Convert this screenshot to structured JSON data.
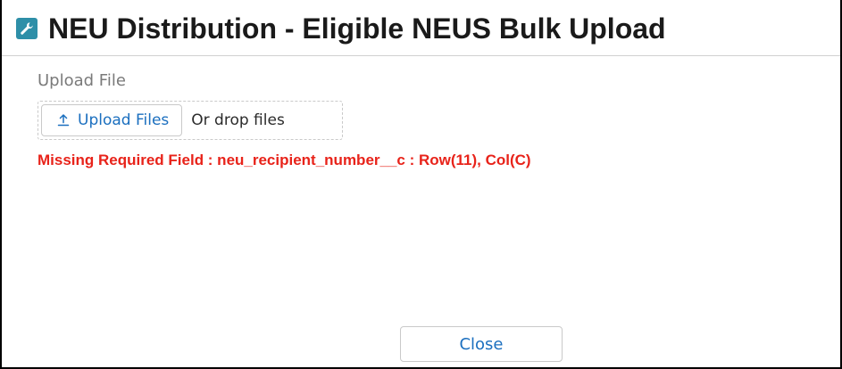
{
  "modal": {
    "title": "NEU Distribution - Eligible NEUS Bulk Upload",
    "title_icon": "wrench-icon",
    "accent_color": "#2e8fa8"
  },
  "upload": {
    "field_label": "Upload File",
    "button_label": "Upload Files",
    "button_icon": "upload-icon",
    "drop_text": "Or drop files"
  },
  "error": {
    "message": "Missing Required Field : neu_recipient_number__c : Row(11), Col(C)",
    "color": "#e8231a"
  },
  "footer": {
    "close_label": "Close"
  },
  "colors": {
    "link_blue": "#1b6fbf"
  }
}
